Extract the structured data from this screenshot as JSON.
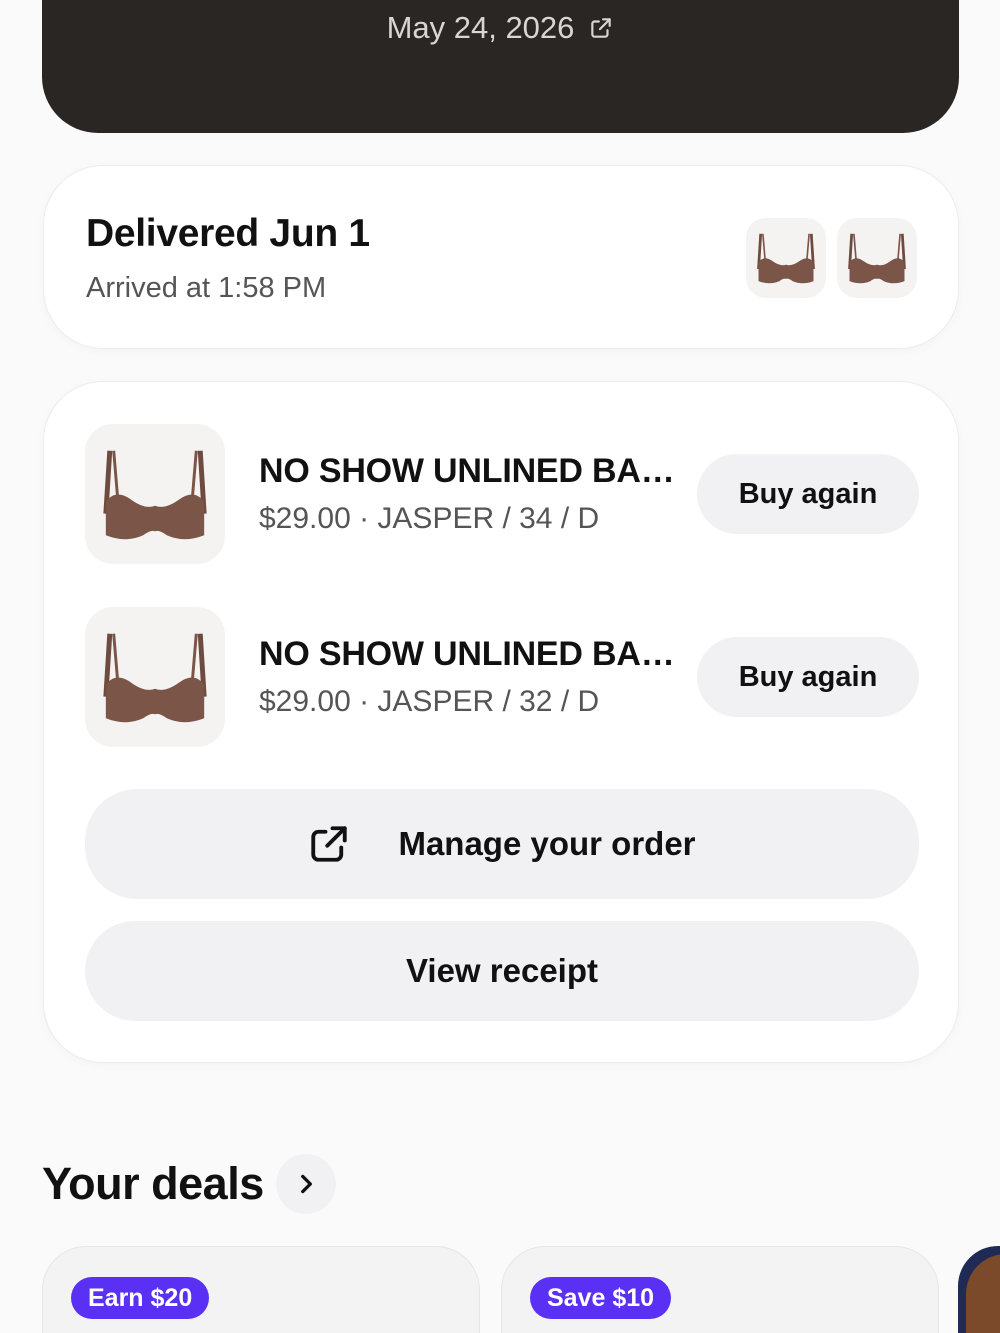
{
  "header": {
    "date": "May 24, 2026",
    "date_link_icon": "external-link-icon"
  },
  "delivery": {
    "title": "Delivered Jun 1",
    "subtitle": "Arrived at 1:58 PM",
    "thumbnail_icon": "bra-product-thumbnail"
  },
  "items": [
    {
      "name": "NO SHOW UNLINED BA…",
      "meta": "$29.00 · JASPER / 34 / D",
      "button": "Buy again",
      "color": "#7a5548"
    },
    {
      "name": "NO SHOW UNLINED BA…",
      "meta": "$29.00 · JASPER / 32 / D",
      "button": "Buy again",
      "color": "#7a5548"
    }
  ],
  "actions": {
    "manage_label": "Manage your order",
    "manage_icon": "external-link-icon",
    "receipt_label": "View receipt"
  },
  "deals": {
    "title": "Your deals",
    "chevron_icon": "chevron-right-icon",
    "cards": [
      {
        "badge": "Earn $20"
      },
      {
        "badge": "Save $10"
      }
    ],
    "badge_color": "#5a31f4"
  }
}
